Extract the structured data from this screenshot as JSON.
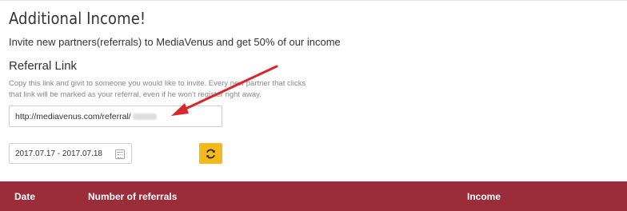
{
  "header": {
    "title": "Additional Income!",
    "subtitle": "Invite new partners(referrals) to MediaVenus and get 50% of our income"
  },
  "referral": {
    "section_label": "Referral Link",
    "help_text": "Copy this link and givit to someone you would like to invite. Every new partner that clicks that link will be marked as your referral, even if he won't register right away.",
    "link_value": "http://mediavenus.com/referral/"
  },
  "filter": {
    "date_range": "2017.07.17 - 2017.07.18"
  },
  "table": {
    "columns": [
      "Date",
      "Number of referrals",
      "Income"
    ]
  },
  "colors": {
    "table_header": "#9b2c3a",
    "refresh_button": "#f5b81a",
    "annotation_arrow": "#d9262b"
  },
  "icons": {
    "refresh": "refresh-icon",
    "calendar": "calendar-icon"
  }
}
